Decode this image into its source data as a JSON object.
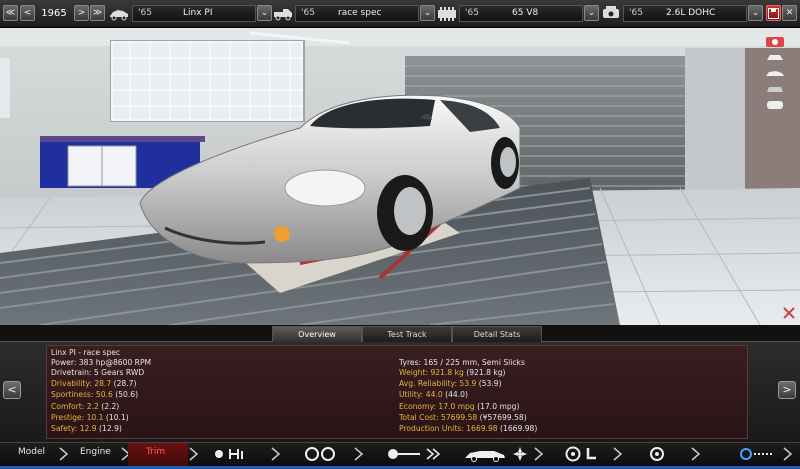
{
  "topbar": {
    "year_label": "1965",
    "model_year": "'65",
    "model_name": "Linx PI",
    "trim_year": "'65",
    "trim_name": "race spec",
    "engine_year": "'65",
    "engine_name": "65 V8",
    "variant_year": "'65",
    "variant_name": "2.6L DOHC"
  },
  "tabs": [
    "Overview",
    "Test Track",
    "Detail Stats"
  ],
  "stats": {
    "left": [
      {
        "label": "Linx PI - race spec",
        "value": ""
      },
      {
        "label": "Power: ",
        "value": "383 hp@8600 RPM"
      },
      {
        "label": "Drivetrain: ",
        "value": "5 Gears RWD"
      },
      {
        "label": "Drivability: ",
        "value": "28.7",
        "extra": " (28.7)"
      },
      {
        "label": "Sportiness: ",
        "value": "50.6",
        "extra": " (50.6)"
      },
      {
        "label": "Comfort: ",
        "value": "2.2",
        "extra": " (2.2)"
      },
      {
        "label": "Prestige: ",
        "value": "10.1",
        "extra": " (10.1)"
      },
      {
        "label": "Safety: ",
        "value": "12.9",
        "extra": " (12.9)"
      }
    ],
    "right": [
      {
        "label": "Tyres: ",
        "value": "165 / 225 mm, Semi Slicks"
      },
      {
        "label": "Weight: ",
        "value": "921.8 kg",
        "extra": " (921.8 kg)"
      },
      {
        "label": "Avg. Reliability: ",
        "value": "53.9",
        "extra": " (53.9)"
      },
      {
        "label": "Utility: ",
        "value": "44.0",
        "extra": " (44.0)"
      },
      {
        "label": "Economy: ",
        "value": "17.0 mpg",
        "extra": " (17.0 mpg)"
      },
      {
        "label": "Total Cost: ",
        "value": "57699.58",
        "extra": " (¥57699.58)"
      },
      {
        "label": "Production Units: ",
        "value": "1669.98",
        "extra": " (1669.98)"
      }
    ]
  },
  "bottom_nav": {
    "model": "Model",
    "engine": "Engine",
    "trim": "Trim"
  },
  "colors": {
    "accent_red": "#ff6060",
    "highlight_yellow": "#e6b43c",
    "blue_strip": "#1c5fb5"
  }
}
